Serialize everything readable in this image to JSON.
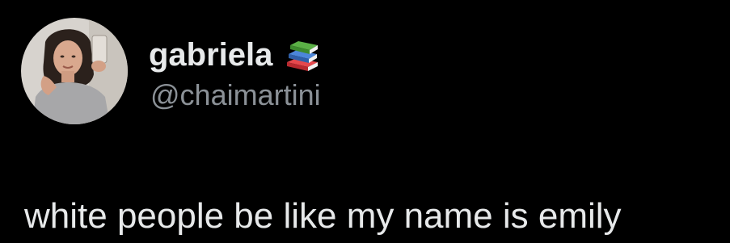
{
  "author": {
    "display_name": "gabriela",
    "handle": "@chaimartini",
    "name_emoji": "books-icon"
  },
  "tweet": {
    "text": "white people be like my name is emily"
  },
  "colors": {
    "background": "#000000",
    "primary_text": "#e7e9ea",
    "secondary_text": "#8b9197"
  }
}
